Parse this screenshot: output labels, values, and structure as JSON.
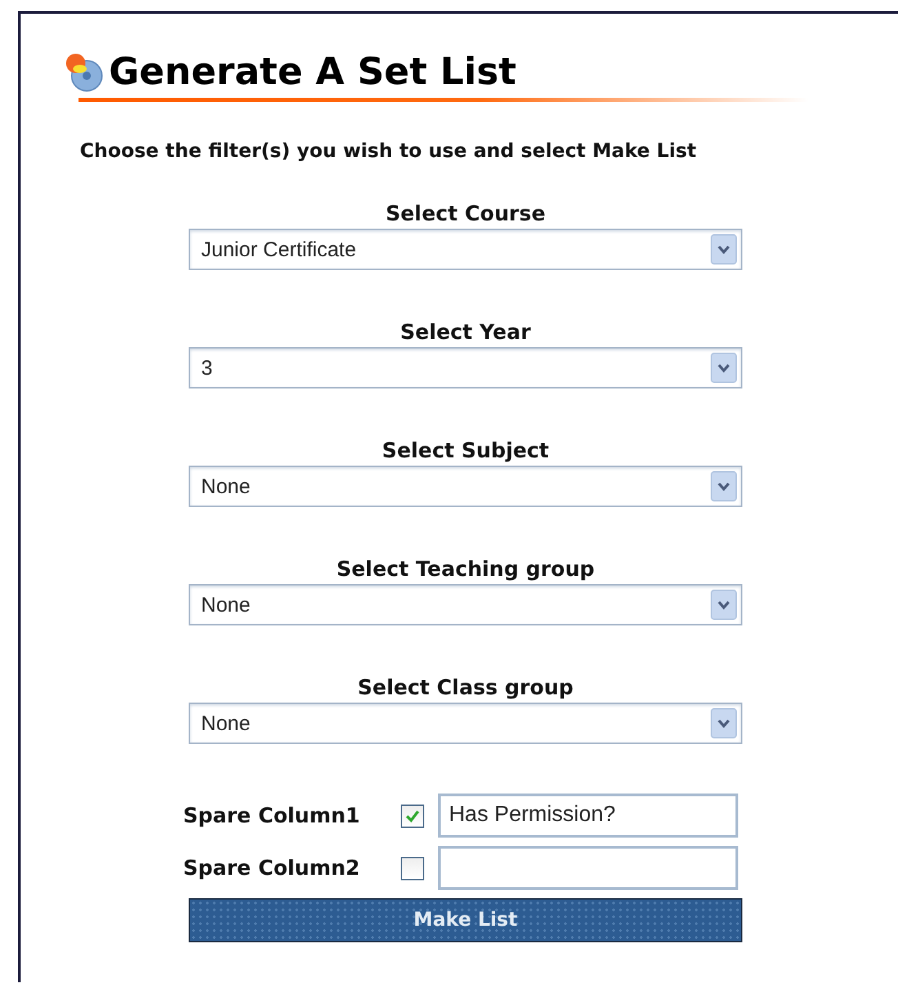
{
  "title": "Generate A Set List",
  "instruction": "Choose the filter(s) you wish to use and select Make List",
  "filters": [
    {
      "label": "Select Course",
      "value": "Junior Certificate"
    },
    {
      "label": "Select Year",
      "value": "3"
    },
    {
      "label": "Select Subject",
      "value": "None"
    },
    {
      "label": "Select Teaching group",
      "value": "None"
    },
    {
      "label": "Select Class group",
      "value": "None"
    }
  ],
  "spare_columns": [
    {
      "label": "Spare Column1",
      "checked": true,
      "value": "Has Permission?"
    },
    {
      "label": "Spare Column2",
      "checked": false
    }
  ],
  "button": "Make List"
}
